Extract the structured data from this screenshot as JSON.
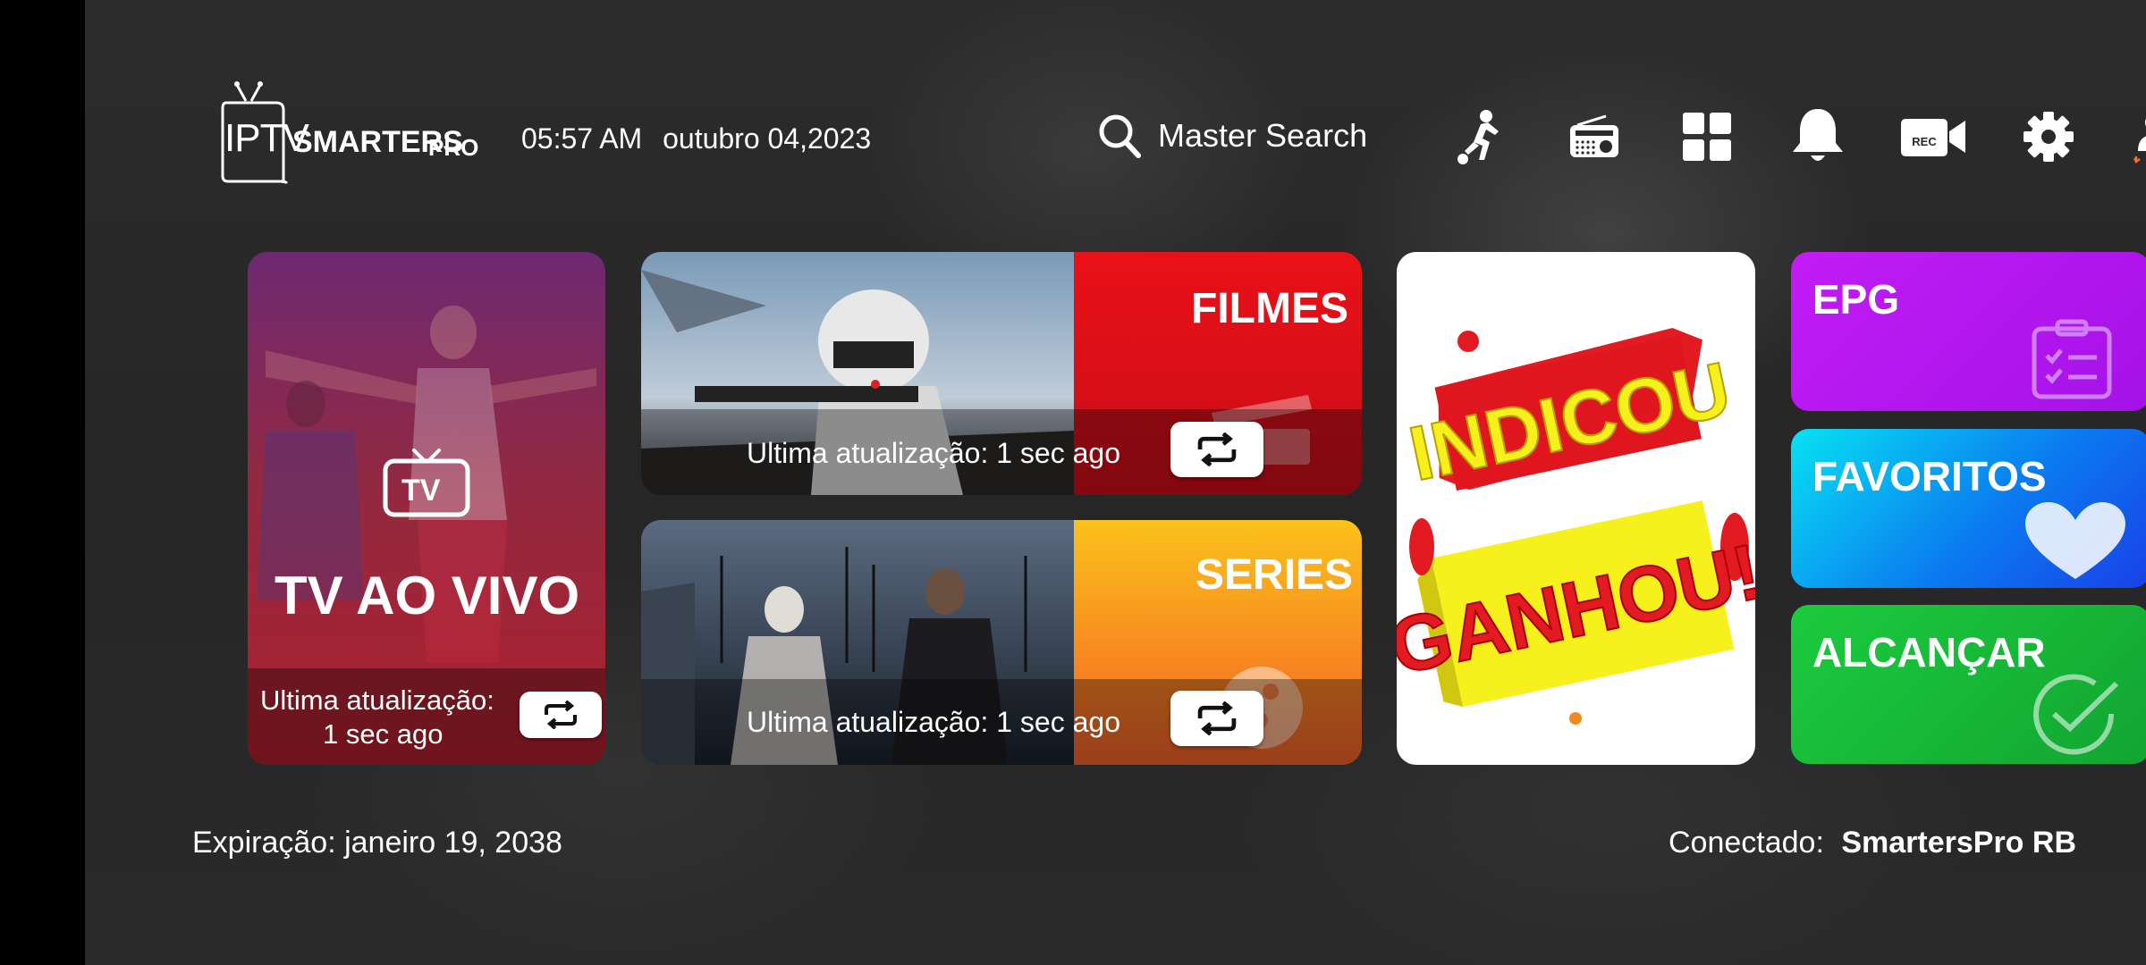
{
  "app": {
    "logo_text_main": "IPTV",
    "logo_text_brand": "SMARTERS",
    "logo_text_suffix": "PRO"
  },
  "header": {
    "time": "05:57 AM",
    "date": "outubro 04,2023",
    "search_label": "Master Search",
    "icons": [
      "sports-icon",
      "radio-icon",
      "grid-icon",
      "bell-icon",
      "rec-camera-icon",
      "settings-gear-icon",
      "switch-user-icon"
    ],
    "rec_label": "REC"
  },
  "tiles": {
    "live": {
      "title": "TV AO VIVO",
      "tv_badge": "TV",
      "update_line1": "Ultima atualização:",
      "update_line2": "1 sec ago",
      "accent": "#b3263a"
    },
    "movies": {
      "title": "FILMES",
      "update": "Ultima atualização: 1 sec ago",
      "accent": "#e0131b"
    },
    "series": {
      "title": "SERIES",
      "update": "Ultima atualização: 1 sec ago",
      "accent": "#f7a21e"
    },
    "promo": {
      "line1": "INDICOU",
      "line2": "GANHOU!"
    },
    "epg": {
      "title": "EPG",
      "accent": "#b716f0"
    },
    "favorites": {
      "title": "FAVORITOS",
      "accent": "#0a7cf0"
    },
    "reach": {
      "title": "ALCANÇAR",
      "accent": "#12b537"
    }
  },
  "footer": {
    "expiration": "Expiração: janeiro 19, 2038",
    "connected_label": "Conectado:",
    "connected_value": "SmartersPro RB"
  }
}
